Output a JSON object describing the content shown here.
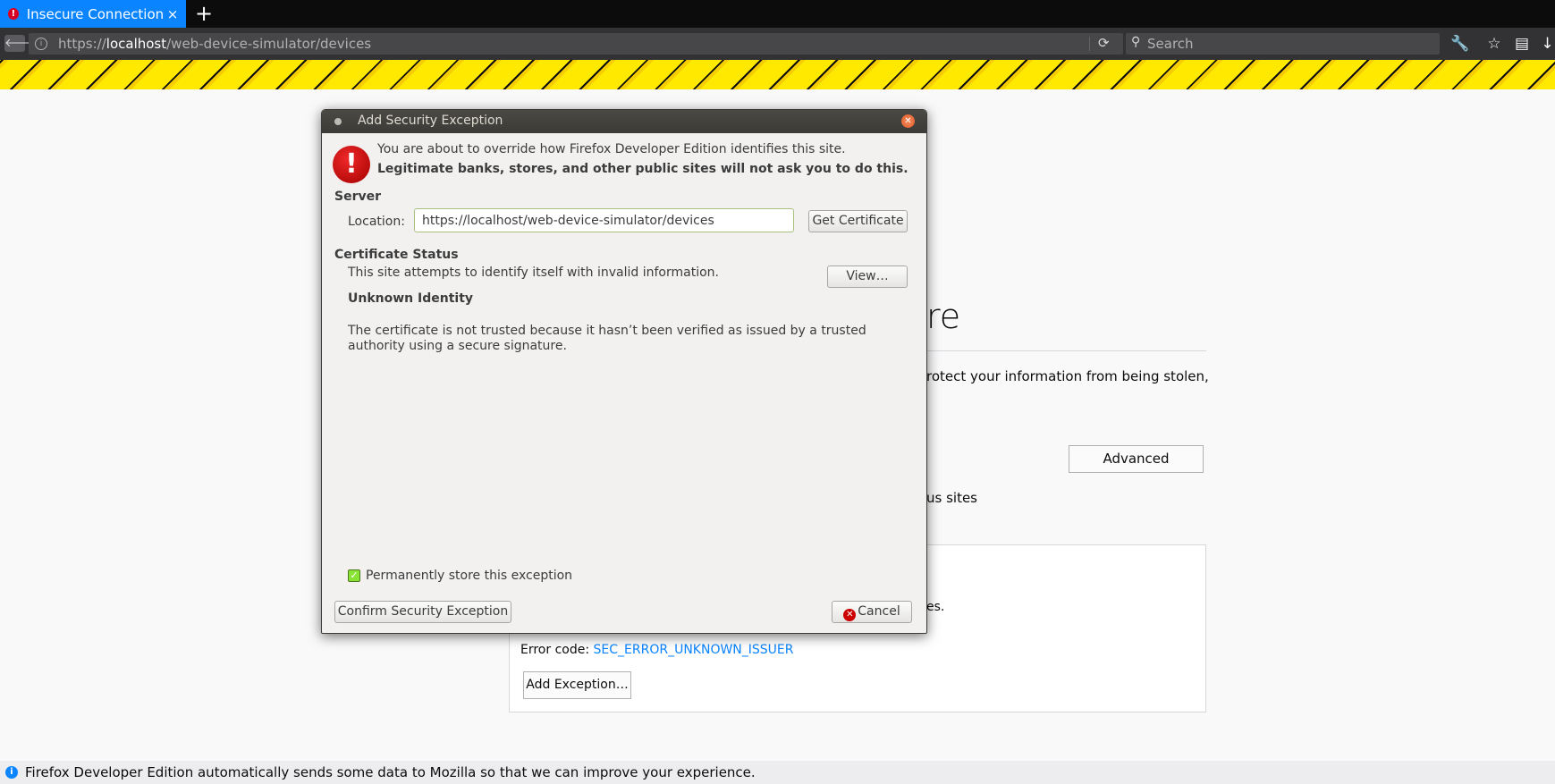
{
  "browser": {
    "tab_title": "Insecure Connection",
    "tab_close": "×",
    "new_tab": "+",
    "url_prefix": "https://",
    "url_host": "localhost",
    "url_path": "/web-device-simulator/devices",
    "search_placeholder": "Search"
  },
  "page": {
    "title_fragment": "re",
    "description_fragment": "rotect your information from being stolen,",
    "advanced_label": "Advanced",
    "tail_fragment": "us sites",
    "advanced_text_fragment": "es.",
    "error_code_label": "Error code: ",
    "error_code": "SEC_ERROR_UNKNOWN_ISSUER",
    "add_exception_label": "Add Exception…"
  },
  "dialog": {
    "title": "Add Security Exception",
    "warning_line1": "You are about to override how Firefox Developer Edition identifies this site.",
    "warning_line2": "Legitimate banks, stores, and other public sites will not ask you to do this.",
    "server_heading": "Server",
    "location_label": "Location:",
    "location_value": "https://localhost/web-device-simulator/devices",
    "get_certificate_label": "Get Certificate",
    "cert_status_heading": "Certificate Status",
    "cert_status_text": "This site attempts to identify itself with invalid information.",
    "view_label": "View…",
    "unknown_identity_heading": "Unknown Identity",
    "unknown_identity_text": "The certificate is not trusted because it hasn’t been verified as issued by a trusted authority using a secure signature.",
    "permanent_label": "Permanently store this exception",
    "permanent_checked": true,
    "confirm_label": "Confirm Security Exception",
    "cancel_label": "Cancel"
  },
  "notification": {
    "text": "Firefox Developer Edition automatically sends some data to Mozilla so that we can improve your experience."
  },
  "colors": {
    "accent": "#0a84ff",
    "error_red": "#d70022",
    "stripe_yellow": "#ffe900",
    "dialog_titlebar": "#3c3b37"
  },
  "icons": [
    "error-icon",
    "close-icon",
    "plus-icon",
    "back-arrow-icon",
    "info-icon",
    "reload-icon",
    "search-icon",
    "wrench-icon",
    "star-icon",
    "library-icon",
    "download-icon",
    "warning-icon",
    "checkbox-icon",
    "cancel-icon"
  ]
}
